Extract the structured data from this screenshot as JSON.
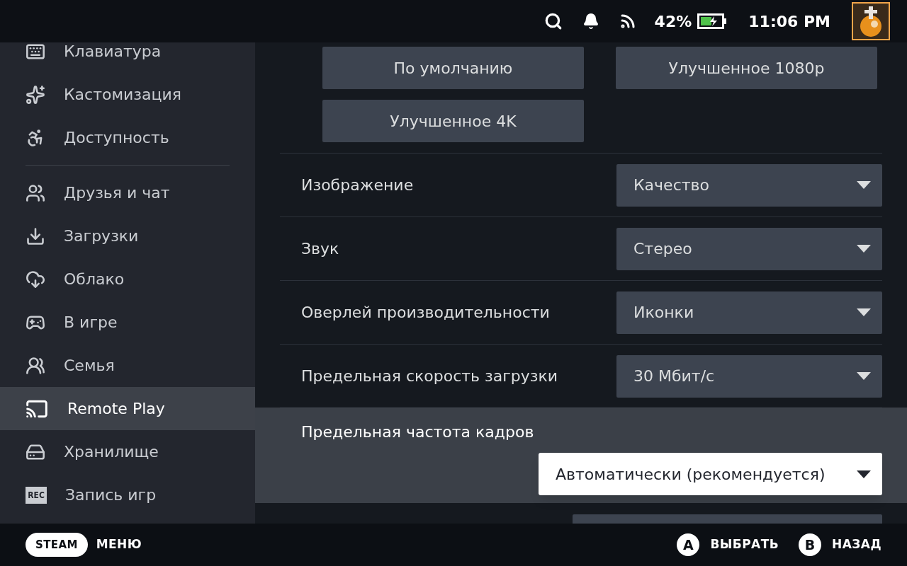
{
  "top_bar": {
    "battery_percent": "42%",
    "time": "11:06 PM"
  },
  "sidebar": {
    "groups": [
      [
        {
          "label": "Клавиатура",
          "selected": false
        },
        {
          "label": "Кастомизация",
          "selected": false
        },
        {
          "label": "Доступность",
          "selected": false
        }
      ],
      [
        {
          "label": "Друзья и чат",
          "selected": false
        },
        {
          "label": "Загрузки",
          "selected": false
        },
        {
          "label": "Облако",
          "selected": false
        },
        {
          "label": "В игре",
          "selected": false
        },
        {
          "label": "Семья",
          "selected": false
        },
        {
          "label": "Remote Play",
          "selected": true
        },
        {
          "label": "Хранилище",
          "selected": false
        },
        {
          "label": "Запись игр",
          "selected": false,
          "badge": "REC"
        }
      ]
    ]
  },
  "presets": [
    "По умолчанию",
    "Улучшенное 1080p",
    "Улучшенное 4K"
  ],
  "settings": [
    {
      "label": "Изображение",
      "value": "Качество",
      "focused": false
    },
    {
      "label": "Звук",
      "value": "Стерео",
      "focused": false
    },
    {
      "label": "Оверлей производительности",
      "value": "Иконки",
      "focused": false
    },
    {
      "label": "Предельная скорость загрузки",
      "value": "30 Мбит/с",
      "focused": false
    },
    {
      "label": "Предельная частота кадров",
      "value": "Автоматически (рекомендуется)",
      "focused": true
    }
  ],
  "footer": {
    "steam_button": "STEAM",
    "menu": "МЕНЮ",
    "hints": [
      {
        "key": "A",
        "label": "ВЫБРАТЬ"
      },
      {
        "key": "B",
        "label": "НАЗАД"
      }
    ]
  }
}
